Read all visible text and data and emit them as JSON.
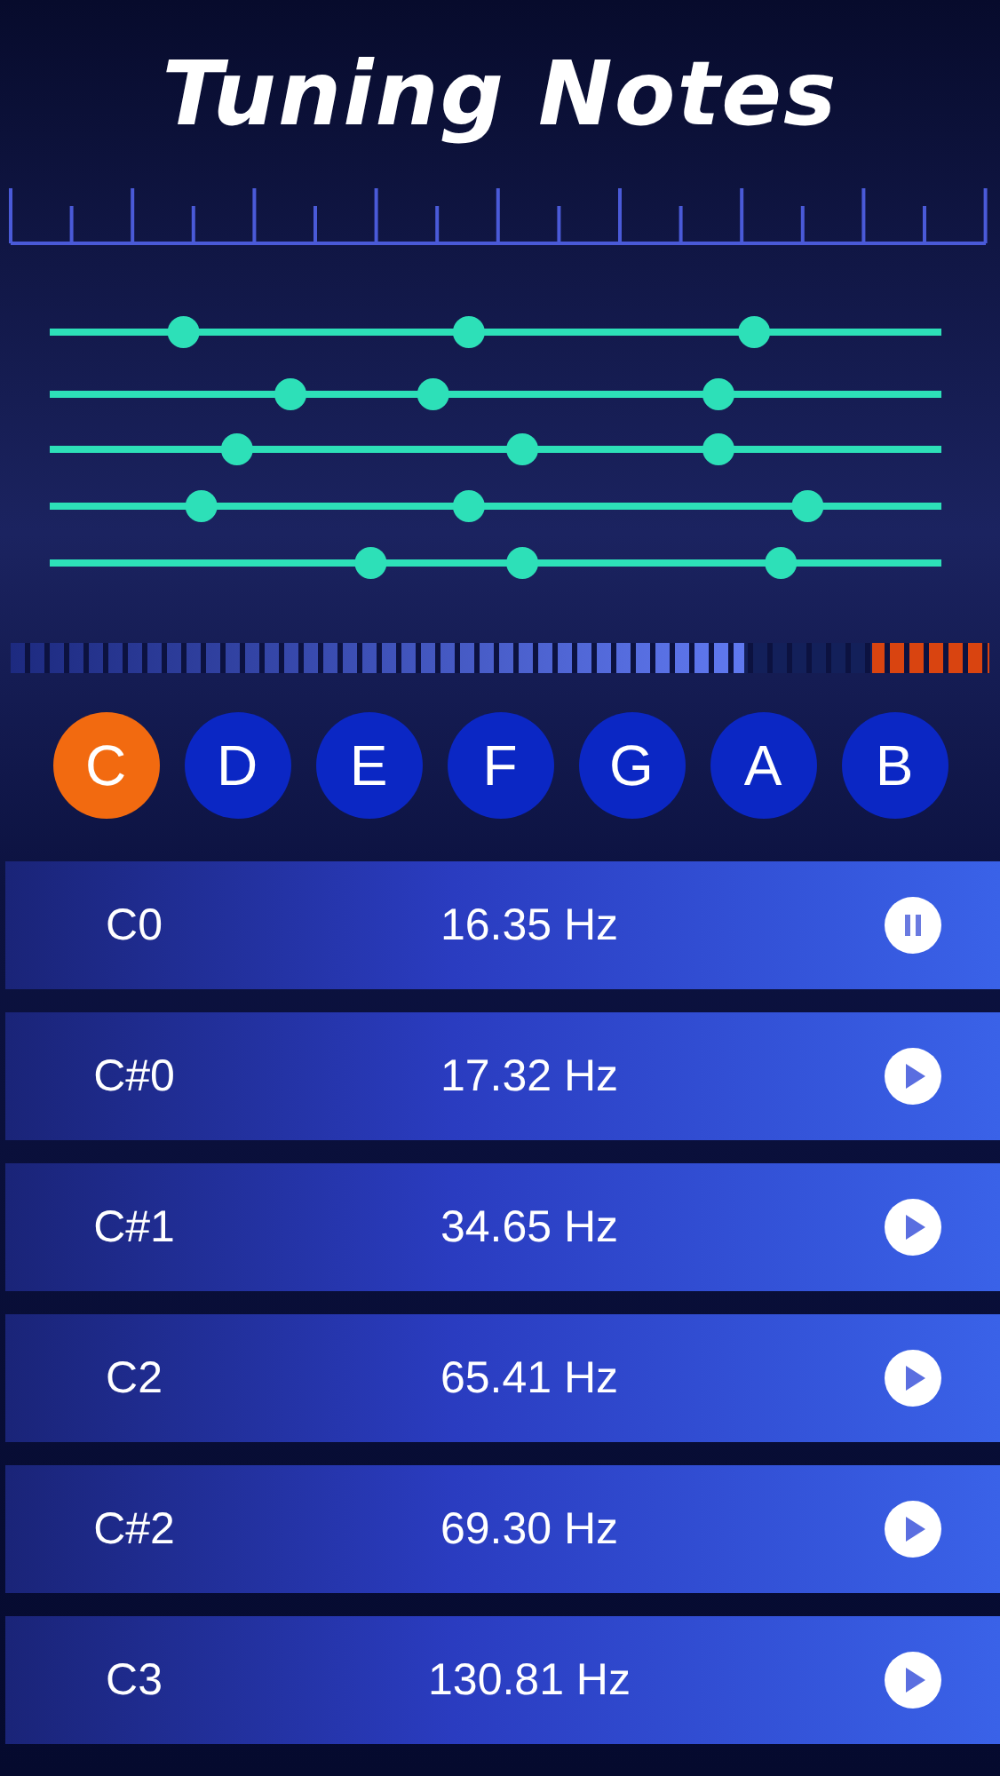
{
  "title": "Tuning Notes",
  "meter": {
    "level": 0.75
  },
  "notes": [
    {
      "label": "C",
      "selected": true
    },
    {
      "label": "D",
      "selected": false
    },
    {
      "label": "E",
      "selected": false
    },
    {
      "label": "F",
      "selected": false
    },
    {
      "label": "G",
      "selected": false
    },
    {
      "label": "A",
      "selected": false
    },
    {
      "label": "B",
      "selected": false
    }
  ],
  "rows": [
    {
      "note": "C0",
      "frequency": "16.35 Hz",
      "playing": true
    },
    {
      "note": "C#0",
      "frequency": "17.32 Hz",
      "playing": false
    },
    {
      "note": "C#1",
      "frequency": "34.65 Hz",
      "playing": false
    },
    {
      "note": "C2",
      "frequency": "65.41 Hz",
      "playing": false
    },
    {
      "note": "C#2",
      "frequency": "69.30 Hz",
      "playing": false
    },
    {
      "note": "C3",
      "frequency": "130.81 Hz",
      "playing": false
    }
  ]
}
